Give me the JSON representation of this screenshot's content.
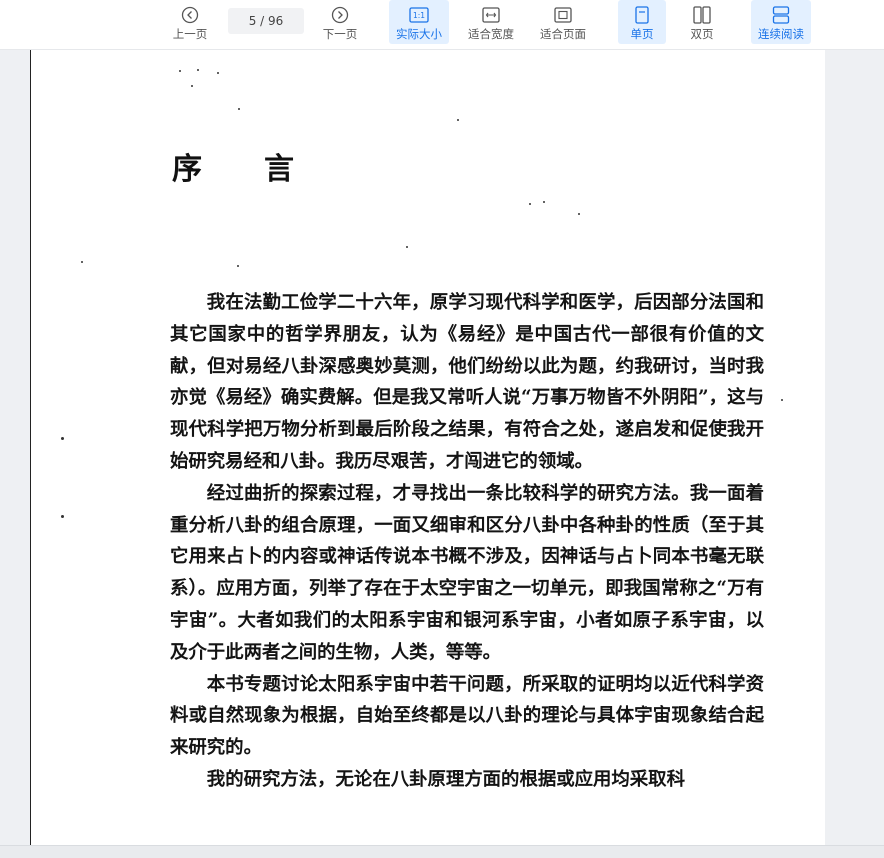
{
  "toolbar": {
    "prev_label": "上一页",
    "next_label": "下一页",
    "current_page": "5",
    "total_pages": "/ 96",
    "actual_size_label": "实际大小",
    "fit_width_label": "适合宽度",
    "fit_page_label": "适合页面",
    "single_page_label": "单页",
    "double_page_label": "双页",
    "continuous_label": "连续阅读",
    "actual_size_icon_text": "1:1",
    "accent_color": "#1a73e8"
  },
  "document": {
    "title": "序言",
    "paragraphs": [
      "我在法勤工俭学二十六年，原学习现代科学和医学，后因部分法国和其它国家中的哲学界朋友，认为《易经》是中国古代一部很有价值的文献，但对易经八卦深感奥妙莫测，他们纷纷以此为题，约我研讨，当时我亦觉《易经》确实费解。但是我又常听人说“万事万物皆不外阴阳”，这与现代科学把万物分析到最后阶段之结果，有符合之处，遂启发和促使我开始研究易经和八卦。我历尽艰苦，才闯进它的领域。",
      "经过曲折的探索过程，才寻找出一条比较科学的研究方法。我一面着重分析八卦的组合原理，一面又细审和区分八卦中各种卦的性质（至于其它用来占卜的内容或神话传说本书概不涉及，因神话与占卜同本书毫无联系）。应用方面，列举了存在于太空宇宙之一切单元，即我国常称之“万有宇宙”。大者如我们的太阳系宇宙和银河系宇宙，小者如原子系宇宙，以及介于此两者之间的生物，人类，等等。",
      "本书专题讨论太阳系宇宙中若干问题，所采取的证明均以近代科学资料或自然现象为根据，自始至终都是以八卦的理论与具体宇宙现象结合起来研究的。",
      "我的研究方法，无论在八卦原理方面的根据或应用均采取科"
    ]
  }
}
